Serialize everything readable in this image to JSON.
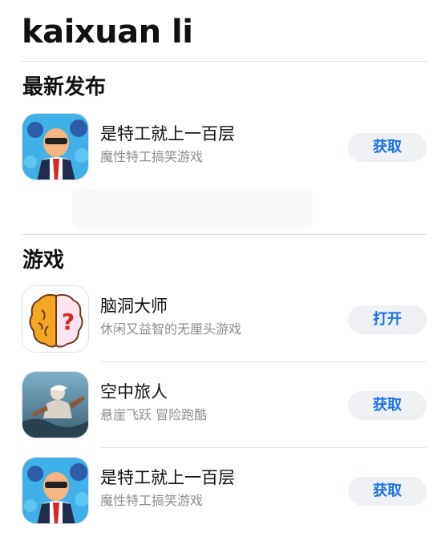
{
  "header": {
    "title": "kaixuan li"
  },
  "sections": [
    {
      "title": "最新发布",
      "apps": [
        {
          "name": "是特工就上一百层",
          "subtitle": "魔性特工搞笑游戏",
          "button": "获取",
          "icon": "secret-agent-icon"
        }
      ]
    },
    {
      "title": "游戏",
      "apps": [
        {
          "name": "脑洞大师",
          "subtitle": "休闲又益智的无厘头游戏",
          "button": "打开",
          "icon": "brain-puzzle-icon"
        },
        {
          "name": "空中旅人",
          "subtitle": "悬崖飞跃 冒险跑酷",
          "button": "获取",
          "icon": "sky-traveler-icon"
        },
        {
          "name": "是特工就上一百层",
          "subtitle": "魔性特工搞笑游戏",
          "button": "获取",
          "icon": "secret-agent-icon"
        }
      ]
    }
  ],
  "colors": {
    "accent": "#1a73e8",
    "button_bg": "#eff0f4",
    "subtitle": "#8e8e93",
    "divider": "#dcdcdf"
  }
}
